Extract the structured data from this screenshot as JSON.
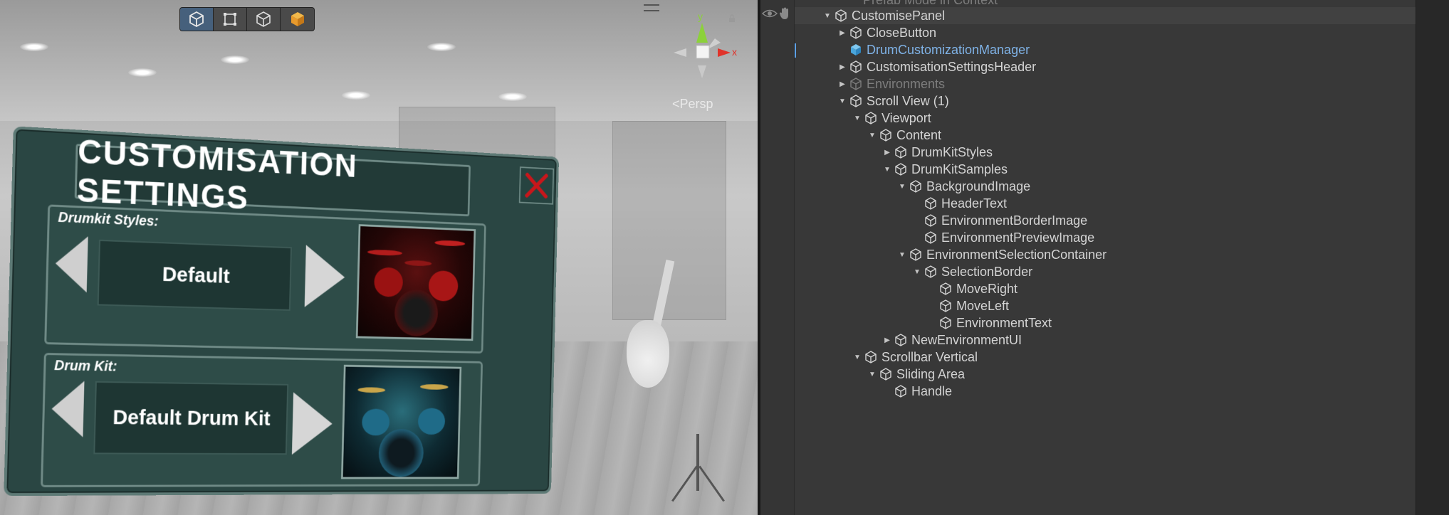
{
  "scene": {
    "persp_label": "<Persp",
    "gizmo": {
      "y_label": "y",
      "x_label": "x"
    },
    "tools": [
      {
        "name": "cube-view-icon",
        "active": true
      },
      {
        "name": "rect-tool-icon",
        "active": false
      },
      {
        "name": "cube-outline-icon",
        "active": false
      },
      {
        "name": "cube-orange-icon",
        "active": false
      }
    ]
  },
  "panel": {
    "title": "CUSTOMISATION SETTINGS",
    "close_label": "X",
    "drumkit_styles": {
      "label": "Drumkit Styles:",
      "value": "Default"
    },
    "drum_kit": {
      "label": "Drum Kit:",
      "value": "Default Drum Kit"
    }
  },
  "hierarchy": {
    "top_row": "Prefab Mode in Context",
    "rows": [
      {
        "label": "CustomisePanel",
        "depth": 0,
        "fold": "open",
        "highlight": true
      },
      {
        "label": "CloseButton",
        "depth": 1,
        "fold": "closed"
      },
      {
        "label": "DrumCustomizationManager",
        "depth": 1,
        "fold": "none",
        "selected": true
      },
      {
        "label": "CustomisationSettingsHeader",
        "depth": 1,
        "fold": "closed"
      },
      {
        "label": "Environments",
        "depth": 1,
        "fold": "closed",
        "dim": true
      },
      {
        "label": "Scroll View (1)",
        "depth": 1,
        "fold": "open"
      },
      {
        "label": "Viewport",
        "depth": 2,
        "fold": "open"
      },
      {
        "label": "Content",
        "depth": 3,
        "fold": "open"
      },
      {
        "label": "DrumKitStyles",
        "depth": 4,
        "fold": "closed"
      },
      {
        "label": "DrumKitSamples",
        "depth": 4,
        "fold": "open"
      },
      {
        "label": "BackgroundImage",
        "depth": 5,
        "fold": "open"
      },
      {
        "label": "HeaderText",
        "depth": 6,
        "fold": "none"
      },
      {
        "label": "EnvironmentBorderImage",
        "depth": 6,
        "fold": "none"
      },
      {
        "label": "EnvironmentPreviewImage",
        "depth": 6,
        "fold": "none"
      },
      {
        "label": "EnvironmentSelectionContainer",
        "depth": 5,
        "fold": "open"
      },
      {
        "label": "SelectionBorder",
        "depth": 6,
        "fold": "open"
      },
      {
        "label": "MoveRight",
        "depth": 7,
        "fold": "none"
      },
      {
        "label": "MoveLeft",
        "depth": 7,
        "fold": "none"
      },
      {
        "label": "EnvironmentText",
        "depth": 7,
        "fold": "none"
      },
      {
        "label": "NewEnvironmentUI",
        "depth": 4,
        "fold": "closed"
      },
      {
        "label": "Scrollbar Vertical",
        "depth": 2,
        "fold": "open"
      },
      {
        "label": "Sliding Area",
        "depth": 3,
        "fold": "open"
      },
      {
        "label": "Handle",
        "depth": 4,
        "fold": "none"
      }
    ]
  },
  "colors": {
    "panel_bg": "#2a4643",
    "selected_text": "#7fb2e6",
    "close_red": "#c8161b",
    "active_tool": "#46607c"
  }
}
